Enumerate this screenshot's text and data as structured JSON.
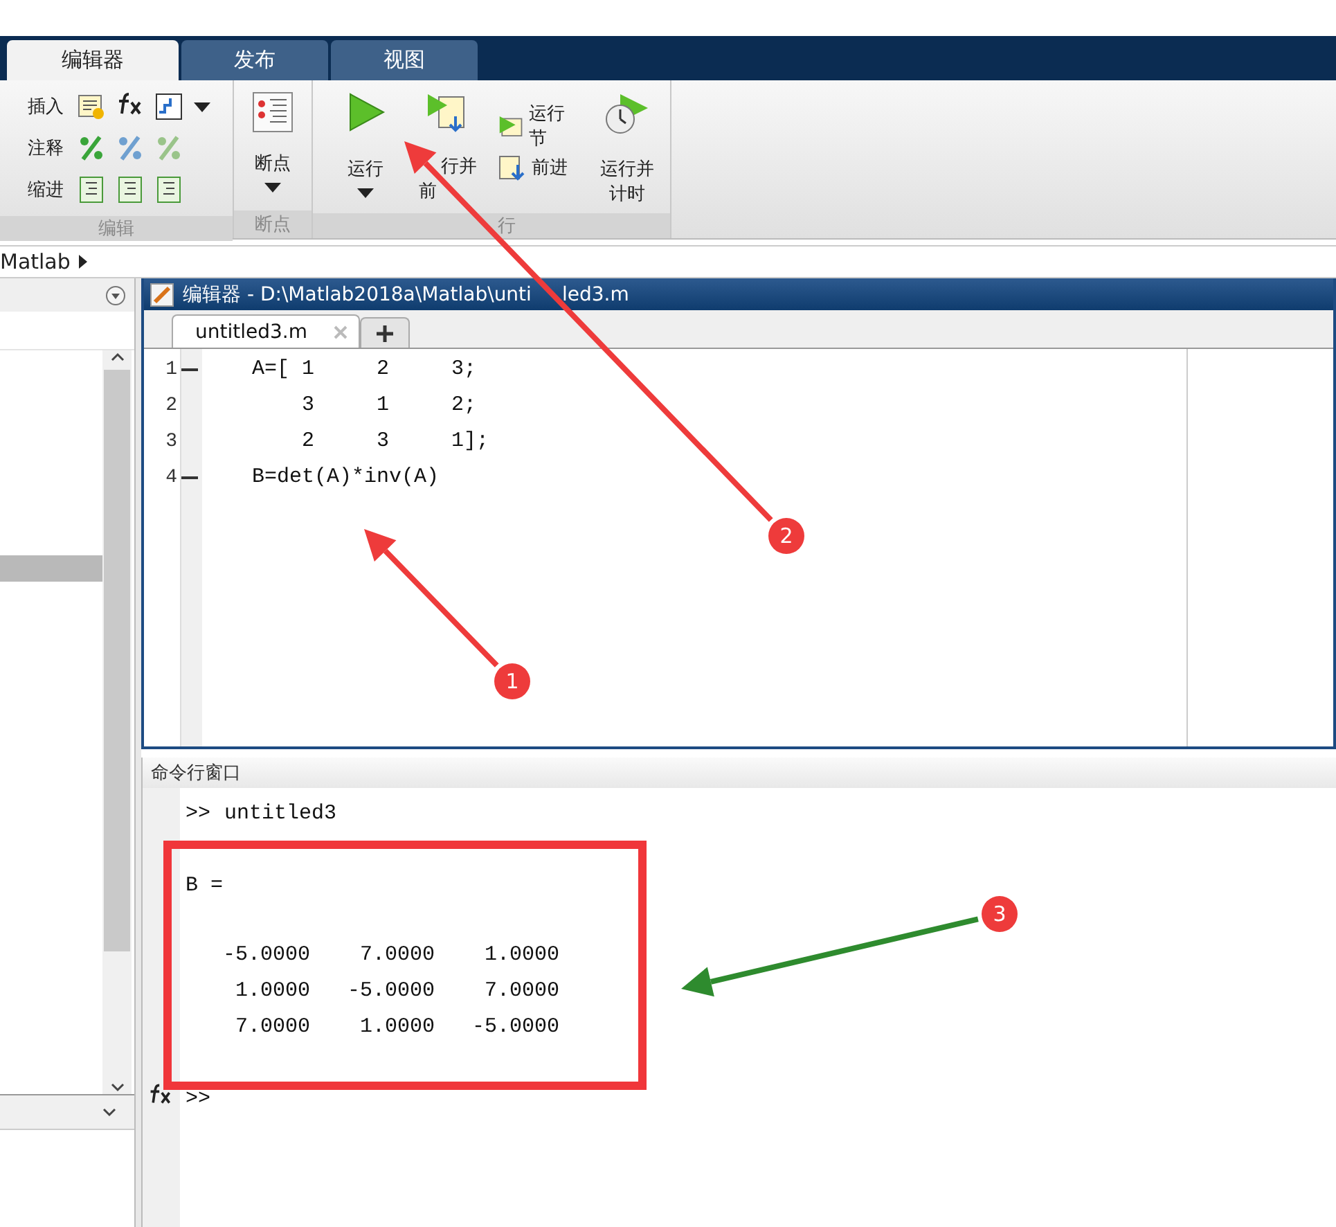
{
  "toolstrip": {
    "tabs": [
      {
        "label": "编辑器",
        "selected": true
      },
      {
        "label": "发布",
        "selected": false
      },
      {
        "label": "视图",
        "selected": false
      }
    ],
    "edit_section": {
      "rows": [
        {
          "label": "插入",
          "kind": "insert"
        },
        {
          "label": "注释",
          "kind": "comment"
        },
        {
          "label": "缩进",
          "kind": "indent"
        }
      ],
      "label": "编辑"
    },
    "breakpoint_section": {
      "button": "断点",
      "label": "断点"
    },
    "run_section": {
      "label": "行",
      "buttons": [
        {
          "kind": "large_menu",
          "lines": [
            "运行"
          ]
        },
        {
          "kind": "large",
          "lines": [
            "行并",
            "前"
          ]
        },
        {
          "kind": "small_pair",
          "items": [
            "运行节",
            "前进"
          ]
        },
        {
          "kind": "large",
          "lines": [
            "运行并",
            "计时"
          ]
        }
      ]
    }
  },
  "address": {
    "folder": "Matlab"
  },
  "editor": {
    "title": [
      "编辑器 - D:\\Matlab2018a\\Matlab\\unti",
      "led3.m"
    ],
    "file_tab": "untitled3.m",
    "lines": [
      {
        "number": "1",
        "executable": true,
        "code": "A=[ 1     2     3;"
      },
      {
        "number": "2",
        "executable": false,
        "code": "    3     1     2;"
      },
      {
        "number": "3",
        "executable": false,
        "code": "    2     3     1];"
      },
      {
        "number": "4",
        "executable": true,
        "code": "B=det(A)*inv(A)"
      }
    ]
  },
  "command_window": {
    "title": "命令行窗口",
    "prompt": ">>",
    "command": "untitled3",
    "variable_line": "B =",
    "rows": [
      [
        "-5.0000",
        "7.0000",
        "1.0000"
      ],
      [
        "1.0000",
        "-5.0000",
        "7.0000"
      ],
      [
        "7.0000",
        "1.0000",
        "-5.0000"
      ]
    ],
    "input_prompt": ">>"
  },
  "annotations": [
    {
      "number": "1",
      "color": "#ee3b3b"
    },
    {
      "number": "2",
      "color": "#ee3b3b"
    },
    {
      "number": "3",
      "color": "#2e8b2e"
    }
  ]
}
